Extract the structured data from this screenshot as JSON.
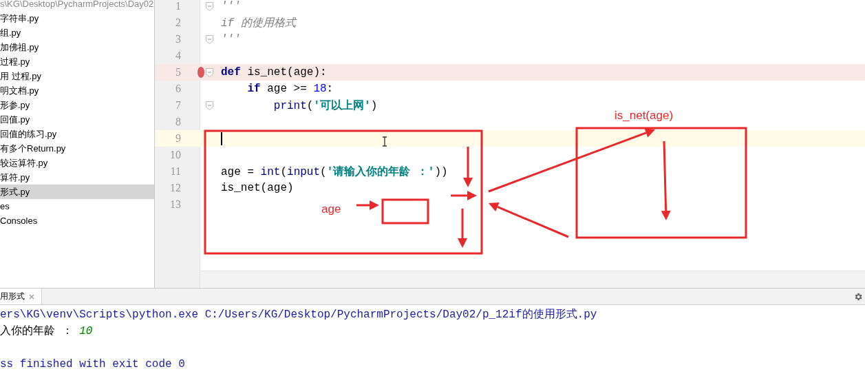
{
  "project_tree": {
    "path": "s\\KG\\Desktop\\PycharmProjects\\Day02",
    "items": [
      {
        "label": "字符串.py",
        "selected": false
      },
      {
        "label": "组.py",
        "selected": false
      },
      {
        "label": "加佛祖.py",
        "selected": false
      },
      {
        "label": "过程.py",
        "selected": false
      },
      {
        "label": "用 过程.py",
        "selected": false
      },
      {
        "label": "明文档.py",
        "selected": false
      },
      {
        "label": "形参.py",
        "selected": false
      },
      {
        "label": "回值.py",
        "selected": false
      },
      {
        "label": "回值的练习.py",
        "selected": false
      },
      {
        "label": "有多个Return.py",
        "selected": false
      },
      {
        "label": "较运算符.py",
        "selected": false
      },
      {
        "label": "算符.py",
        "selected": false
      },
      {
        "label": "形式.py",
        "selected": true
      },
      {
        "label": "es",
        "selected": false
      },
      {
        "label": "Consoles",
        "selected": false
      }
    ]
  },
  "editor": {
    "lines": [
      {
        "number": "1",
        "fold": true,
        "breakpoint": false,
        "current": false,
        "tokens": [
          {
            "kind": "comment",
            "text": "'''"
          }
        ]
      },
      {
        "number": "2",
        "fold": false,
        "breakpoint": false,
        "current": false,
        "tokens": [
          {
            "kind": "comment",
            "text": "if 的使用格式"
          }
        ]
      },
      {
        "number": "3",
        "fold": true,
        "breakpoint": false,
        "current": false,
        "tokens": [
          {
            "kind": "comment",
            "text": "'''"
          }
        ]
      },
      {
        "number": "4",
        "fold": false,
        "breakpoint": false,
        "current": false
      },
      {
        "number": "5",
        "fold": true,
        "breakpoint": true,
        "current": false,
        "tokens": [
          {
            "kind": "keyword",
            "text": "def"
          },
          {
            "kind": "plain",
            "text": " is_net(age):"
          }
        ],
        "children": [
          {
            "number": "6",
            "fold": false,
            "breakpoint": false,
            "current": false,
            "tokens": [
              {
                "kind": "keyword",
                "text": "if"
              },
              {
                "kind": "plain",
                "text": " age >= "
              },
              {
                "kind": "number",
                "text": "18"
              },
              {
                "kind": "plain",
                "text": ":"
              }
            ],
            "children": [
              {
                "number": "7",
                "fold": true,
                "breakpoint": false,
                "current": false,
                "tokens": [
                  {
                    "kind": "builtin",
                    "text": "print"
                  },
                  {
                    "kind": "plain",
                    "text": "("
                  },
                  {
                    "kind": "string",
                    "text": "'可以上网'"
                  },
                  {
                    "kind": "plain",
                    "text": ")"
                  }
                ]
              }
            ]
          }
        ]
      },
      {
        "number": "8",
        "fold": false,
        "breakpoint": false,
        "current": false
      },
      {
        "number": "9",
        "fold": false,
        "breakpoint": false,
        "current": true
      },
      {
        "number": "10",
        "fold": false,
        "breakpoint": false,
        "current": false
      },
      {
        "number": "11",
        "fold": false,
        "breakpoint": false,
        "current": false,
        "tokens": [
          {
            "kind": "plain",
            "text": "age = "
          },
          {
            "kind": "builtin",
            "text": "int"
          },
          {
            "kind": "plain",
            "text": "("
          },
          {
            "kind": "builtin",
            "text": "input"
          },
          {
            "kind": "plain",
            "text": "("
          },
          {
            "kind": "string",
            "text": "'请输入你的年龄 ：'"
          },
          {
            "kind": "plain",
            "text": "))"
          }
        ]
      },
      {
        "number": "12",
        "fold": false,
        "breakpoint": false,
        "current": false,
        "tokens": [
          {
            "kind": "plain",
            "text": "is_net(age)"
          }
        ]
      },
      {
        "number": "13",
        "fold": false,
        "breakpoint": false,
        "current": false
      }
    ]
  },
  "annotations": {
    "labels": [
      "is_net(age)",
      "age"
    ]
  },
  "run_panel": {
    "tab": {
      "label": "用形式",
      "selected": true
    },
    "lines": [
      {
        "kind": "command",
        "segments": [
          {
            "kind": "command",
            "text": "ers\\KG\\venv\\Scripts\\python.exe C:/Users/KG/Desktop/PycharmProjects/Day02/p_12if的使用形式.py"
          }
        ]
      },
      {
        "kind": "prompt",
        "segments": [
          {
            "kind": "output",
            "text": "入你的年龄 ："
          },
          {
            "kind": "input",
            "text": "10"
          }
        ]
      },
      {
        "kind": "exit",
        "segments": [
          {
            "kind": "command",
            "text": "ss finished with exit code 0"
          }
        ]
      }
    ]
  }
}
